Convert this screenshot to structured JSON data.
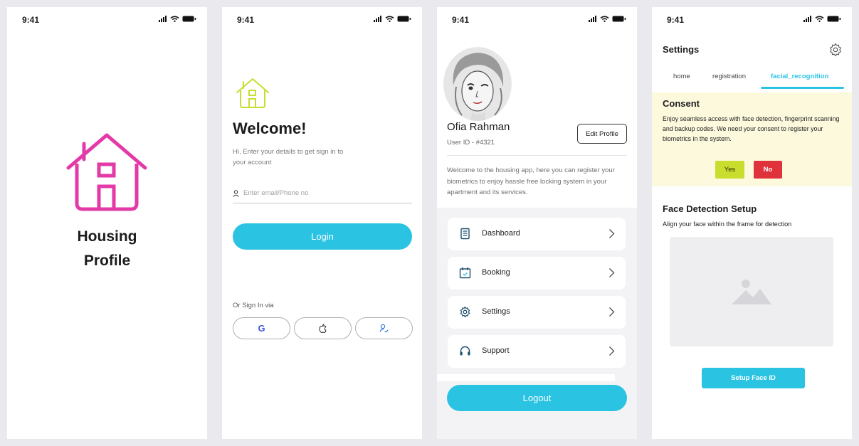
{
  "colors": {
    "accent": "#2ac3e2",
    "brand_pink": "#e33aa8",
    "logo_lime": "#c9dd2f",
    "yes": "#c9dd2f",
    "no": "#e0323a",
    "consent_bg": "#fcf9dd"
  },
  "status": {
    "time": "9:41",
    "icons": [
      "signal-icon",
      "wifi-icon",
      "battery-icon"
    ]
  },
  "splash": {
    "title_line1": "Housing",
    "title_line2": "Profile",
    "logo_icon": "house-icon"
  },
  "login": {
    "logo_icon": "house-icon",
    "title": "Welcome!",
    "subtitle": "Hi, Enter your details to get sign in to your account",
    "email_icon": "user-icon",
    "email_placeholder": "Enter email/Phone no",
    "login_label": "Login",
    "signin_via": "Or Sign In via",
    "social": [
      {
        "name": "google",
        "glyph": "G",
        "icon": "google-icon"
      },
      {
        "name": "apple",
        "icon": "apple-icon"
      },
      {
        "name": "face",
        "icon": "user-sign-icon"
      }
    ]
  },
  "profile": {
    "name": "Ofia Rahman",
    "user_id": "User ID - #4321",
    "edit_label": "Edit Profile",
    "description": "Welcome to the housing app, here you can register your biometrics to enjoy hassle free locking system in your apartment and its services.",
    "menu": [
      {
        "label": "Dashboard",
        "icon": "dashboard-icon"
      },
      {
        "label": "Booking",
        "icon": "calendar-icon"
      },
      {
        "label": "Settings",
        "icon": "gear-icon"
      },
      {
        "label": "Support",
        "icon": "headset-icon"
      }
    ],
    "logout_label": "Logout"
  },
  "settings": {
    "title": "Settings",
    "tabs": [
      {
        "label": "home",
        "active": false
      },
      {
        "label": "registration",
        "active": false
      },
      {
        "label": "facial_recognition",
        "active": true
      }
    ],
    "consent_title": "Consent",
    "consent_text": "Enjoy seamless access with face detection, fingerprint scanning and backup codes. We need your consent to register your biometrics in the system.",
    "yes_label": "Yes",
    "no_label": "No",
    "face_title": "Face Detection Setup",
    "face_subtitle": "Align your face within the frame for detection",
    "frame_icon": "image-placeholder-icon",
    "setup_label": "Setup Face ID"
  }
}
